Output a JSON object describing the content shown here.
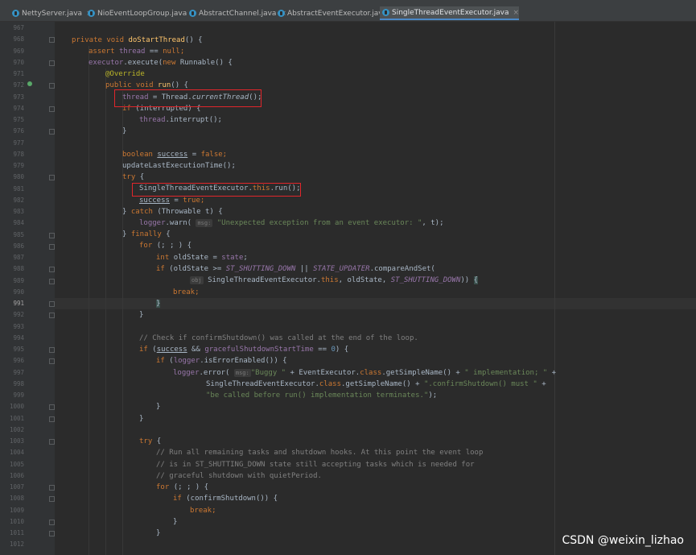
{
  "tabs": [
    {
      "label": "NettyServer.java",
      "active": false
    },
    {
      "label": "NioEventLoopGroup.java",
      "active": false
    },
    {
      "label": "AbstractChannel.java",
      "active": false
    },
    {
      "label": "AbstractEventExecutor.java",
      "active": false
    },
    {
      "label": "SingleThreadEventExecutor.java",
      "active": true
    }
  ],
  "close_glyph": "×",
  "line_numbers": [
    "967",
    "968",
    "969",
    "970",
    "971",
    "972",
    "973",
    "974",
    "975",
    "976",
    "977",
    "978",
    "979",
    "980",
    "981",
    "982",
    "983",
    "984",
    "985",
    "986",
    "987",
    "988",
    "989",
    "990",
    "991",
    "992",
    "993",
    "994",
    "995",
    "996",
    "997",
    "998",
    "999",
    "1000",
    "1001",
    "1002",
    "1003",
    "1004",
    "1005",
    "1006",
    "1007",
    "1008",
    "1009",
    "1010",
    "1011",
    "1012"
  ],
  "current_line": "991",
  "code": {
    "l968": {
      "kw1": "private void ",
      "fn": "doStartThread",
      "rest": "() {"
    },
    "l969": {
      "kw": "assert ",
      "fld": "thread",
      "mid": " == ",
      "kw2": "null",
      "end": ";"
    },
    "l970": {
      "fld": "executor",
      "mid": ".execute(",
      "kw": "new ",
      "rest": "Runnable() {"
    },
    "l971": {
      "ann": "@Override"
    },
    "l972": {
      "kw": "public void ",
      "fn": "run",
      "rest": "() {"
    },
    "l973": {
      "fld": "thread",
      "mid": " = Thread.",
      "ital": "currentThread",
      "end": "();"
    },
    "l974": {
      "kw": "if ",
      "rest": "(interrupted) {"
    },
    "l975": {
      "fld": "thread",
      "rest": ".interrupt();"
    },
    "l976": {
      "rest": "}"
    },
    "l978": {
      "kw": "boolean ",
      "ul": "success",
      "mid": " = ",
      "kw2": "false",
      "end": ";"
    },
    "l979": {
      "rest": "updateLastExecutionTime();"
    },
    "l980": {
      "kw": "try ",
      "rest": "{"
    },
    "l981": {
      "a": "SingleThreadEventExecutor.",
      "kw": "this",
      "b": ".run();"
    },
    "l982": {
      "ul": "success",
      "mid": " = ",
      "kw": "true",
      "end": ";"
    },
    "l983": {
      "a": "} ",
      "kw": "catch ",
      "b": "(Throwable t) {"
    },
    "l984": {
      "fld": "logger",
      "a": ".warn( ",
      "hint": "msg:",
      "str": "\"Unexpected exception from an event executor: \"",
      "b": ", t);"
    },
    "l985": {
      "a": "} ",
      "kw": "finally ",
      "b": "{"
    },
    "l986": {
      "kw": "for ",
      "rest": "(; ; ) {"
    },
    "l987": {
      "kw": "int ",
      "a": "oldState = ",
      "fld": "state",
      "b": ";"
    },
    "l988": {
      "kw": "if ",
      "a": "(oldState >= ",
      "s1": "ST_SHUTTING_DOWN",
      "b": " || ",
      "s2": "STATE_UPDATER",
      "c": ".compareAndSet("
    },
    "l989": {
      "hint": "obj",
      "a": " SingleThreadEventExecutor.",
      "kw": "this",
      "b": ", oldState, ",
      "s1": "ST_SHUTTING_DOWN",
      "c": ")) ",
      "brace": "{"
    },
    "l990": {
      "kw": "break",
      "end": ";"
    },
    "l991": {
      "brace": "}"
    },
    "l992": {
      "rest": "}"
    },
    "l994": {
      "cmt": "// Check if confirmShutdown() was called at the end of the loop."
    },
    "l995": {
      "kw": "if ",
      "a": "(",
      "ul": "success",
      "b": " && ",
      "fld": "gracefulShutdownStartTime",
      "c": " == ",
      "num": "0",
      "d": ") {"
    },
    "l996": {
      "kw": "if ",
      "a": "(",
      "fld": "logger",
      "b": ".isErrorEnabled()) {"
    },
    "l997": {
      "fld": "logger",
      "a": ".error( ",
      "hint": "msg:",
      "str1": "\"Buggy \"",
      "b": " + EventExecutor.",
      "kw": "class",
      "c": ".getSimpleName() + ",
      "str2": "\" implementation; \"",
      "d": " +"
    },
    "l998": {
      "a": "SingleThreadEventExecutor.",
      "kw": "class",
      "b": ".getSimpleName() + ",
      "str": "\".confirmShutdown() must \"",
      "c": " +"
    },
    "l999": {
      "str": "\"be called before run() implementation terminates.\"",
      "end": ");"
    },
    "l1000": {
      "rest": "}"
    },
    "l1001": {
      "rest": "}"
    },
    "l1003": {
      "kw": "try ",
      "rest": "{"
    },
    "l1004": {
      "cmt": "// Run all remaining tasks and shutdown hooks. At this point the event loop"
    },
    "l1005": {
      "cmt": "// is in ST_SHUTTING_DOWN state still accepting tasks which is needed for"
    },
    "l1006": {
      "cmt": "// graceful shutdown with quietPeriod."
    },
    "l1007": {
      "kw": "for ",
      "rest": "(; ; ) {"
    },
    "l1008": {
      "kw": "if ",
      "rest": "(confirmShutdown()) {"
    },
    "l1009": {
      "kw": "break",
      "end": ";"
    },
    "l1010": {
      "rest": "}"
    },
    "l1011": {
      "rest": "}"
    }
  },
  "watermark": "CSDN @weixin_lizhao"
}
